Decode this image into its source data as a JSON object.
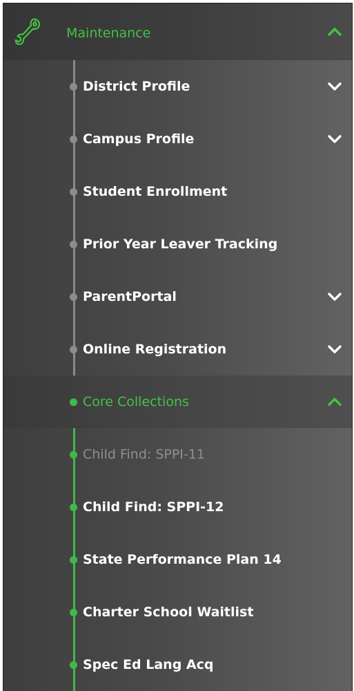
{
  "colors": {
    "accent": "#44c244",
    "line_green": "#3fb94a",
    "line_gray": "#8a8a8a",
    "text": "#ffffff",
    "disabled_text": "#8f8f8f"
  },
  "section": {
    "title": "Maintenance",
    "icon": "wrench-icon",
    "expanded": true
  },
  "items": [
    {
      "label": "District Profile",
      "has_submenu": true,
      "expanded": false
    },
    {
      "label": "Campus Profile",
      "has_submenu": true,
      "expanded": false
    },
    {
      "label": "Student Enrollment"
    },
    {
      "label": "Prior Year Leaver Tracking"
    },
    {
      "label": "ParentPortal",
      "has_submenu": true,
      "expanded": false
    },
    {
      "label": "Online Registration",
      "has_submenu": true,
      "expanded": false
    },
    {
      "label": "Core Collections",
      "has_submenu": true,
      "expanded": true,
      "active": true
    }
  ],
  "subitems": [
    {
      "label": "Child Find: SPPI-11",
      "disabled": true
    },
    {
      "label": "Child Find: SPPI-12"
    },
    {
      "label": "State Performance Plan 14"
    },
    {
      "label": "Charter School Waitlist"
    },
    {
      "label": "Spec Ed Lang Acq"
    }
  ]
}
